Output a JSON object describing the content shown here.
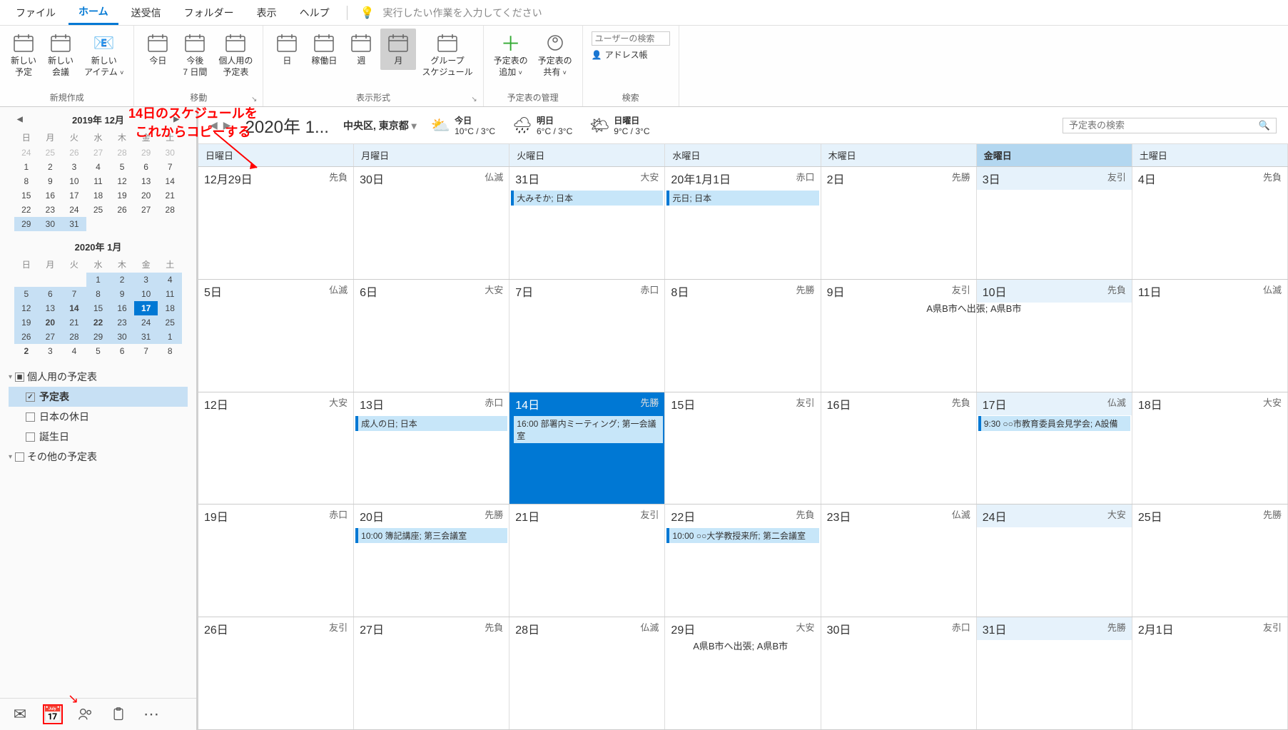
{
  "menubar": {
    "tabs": [
      "ファイル",
      "ホーム",
      "送受信",
      "フォルダー",
      "表示",
      "ヘルプ"
    ],
    "active": 1,
    "tellme": "実行したい作業を入力してください"
  },
  "ribbon": {
    "groups": [
      {
        "label": "新規作成",
        "items": [
          {
            "name": "new-appointment",
            "icon": "calendar-new",
            "label": "新しい\n予定"
          },
          {
            "name": "new-meeting",
            "icon": "calendar-meeting",
            "label": "新しい\n会議"
          },
          {
            "name": "new-items",
            "icon": "items",
            "label": "新しい\nアイテム",
            "dropdown": true
          }
        ]
      },
      {
        "label": "移動",
        "launcher": true,
        "items": [
          {
            "name": "today",
            "icon": "cal-today",
            "label": "今日"
          },
          {
            "name": "next-7-days",
            "icon": "cal-week",
            "label": "今後\n7 日間"
          },
          {
            "name": "personal-calendar",
            "icon": "cal-personal",
            "label": "個人用の\n予定表"
          }
        ]
      },
      {
        "label": "表示形式",
        "launcher": true,
        "items": [
          {
            "name": "day-view",
            "icon": "view-day",
            "label": "日"
          },
          {
            "name": "work-week-view",
            "icon": "view-workweek",
            "label": "稼働日"
          },
          {
            "name": "week-view",
            "icon": "view-week",
            "label": "週"
          },
          {
            "name": "month-view",
            "icon": "view-month",
            "label": "月",
            "active": true
          },
          {
            "name": "schedule-view",
            "icon": "view-schedule",
            "label": "グループ\nスケジュール"
          }
        ]
      },
      {
        "label": "予定表の管理",
        "items": [
          {
            "name": "add-calendar",
            "icon": "plus",
            "label": "予定表の\n追加",
            "dropdown": true
          },
          {
            "name": "share-calendar",
            "icon": "share",
            "label": "予定表の\n共有",
            "dropdown": true
          }
        ]
      },
      {
        "label": "検索",
        "search": true,
        "placeholder": "ユーザーの検索",
        "addressbook": "アドレス帳"
      }
    ]
  },
  "sidebar": {
    "miniCals": [
      {
        "title": "2019年 12月",
        "navLeft": true,
        "navRight": true,
        "dow": [
          "日",
          "月",
          "火",
          "水",
          "木",
          "金",
          "土"
        ],
        "days": [
          {
            "n": 24,
            "muted": true
          },
          {
            "n": 25,
            "muted": true
          },
          {
            "n": 26,
            "muted": true
          },
          {
            "n": 27,
            "muted": true
          },
          {
            "n": 28,
            "muted": true
          },
          {
            "n": 29,
            "muted": true
          },
          {
            "n": 30,
            "muted": true
          },
          {
            "n": 1
          },
          {
            "n": 2
          },
          {
            "n": 3
          },
          {
            "n": 4
          },
          {
            "n": 5
          },
          {
            "n": 6
          },
          {
            "n": 7
          },
          {
            "n": 8
          },
          {
            "n": 9
          },
          {
            "n": 10
          },
          {
            "n": 11
          },
          {
            "n": 12
          },
          {
            "n": 13
          },
          {
            "n": 14
          },
          {
            "n": 15
          },
          {
            "n": 16
          },
          {
            "n": 17
          },
          {
            "n": 18
          },
          {
            "n": 19
          },
          {
            "n": 20
          },
          {
            "n": 21
          },
          {
            "n": 22
          },
          {
            "n": 23
          },
          {
            "n": 24
          },
          {
            "n": 25
          },
          {
            "n": 26
          },
          {
            "n": 27
          },
          {
            "n": 28
          },
          {
            "n": 29,
            "hl": true
          },
          {
            "n": 30,
            "hl": true
          },
          {
            "n": 31,
            "hl": true
          },
          {
            "n": "",
            "muted": true
          },
          {
            "n": "",
            "muted": true
          },
          {
            "n": "",
            "muted": true
          },
          {
            "n": "",
            "muted": true
          }
        ]
      },
      {
        "title": "2020年 1月",
        "dow": [
          "日",
          "月",
          "火",
          "水",
          "木",
          "金",
          "土"
        ],
        "days": [
          {
            "n": "",
            "muted": true
          },
          {
            "n": "",
            "muted": true
          },
          {
            "n": "",
            "muted": true
          },
          {
            "n": 1,
            "hl": true
          },
          {
            "n": 2,
            "hl": true
          },
          {
            "n": 3,
            "hl": true
          },
          {
            "n": 4,
            "hl": true
          },
          {
            "n": 5,
            "hl": true
          },
          {
            "n": 6,
            "hl": true
          },
          {
            "n": 7,
            "hl": true
          },
          {
            "n": 8,
            "hl": true
          },
          {
            "n": 9,
            "hl": true
          },
          {
            "n": 10,
            "hl": true
          },
          {
            "n": 11,
            "hl": true
          },
          {
            "n": 12,
            "hl": true
          },
          {
            "n": 13,
            "hl": true
          },
          {
            "n": 14,
            "hl": true,
            "bold": true
          },
          {
            "n": 15,
            "hl": true
          },
          {
            "n": 16,
            "hl": true
          },
          {
            "n": 17,
            "today": true
          },
          {
            "n": 18,
            "hl": true
          },
          {
            "n": 19,
            "hl": true
          },
          {
            "n": 20,
            "hl": true,
            "bold": true
          },
          {
            "n": 21,
            "hl": true
          },
          {
            "n": 22,
            "hl": true,
            "bold": true
          },
          {
            "n": 23,
            "hl": true
          },
          {
            "n": 24,
            "hl": true
          },
          {
            "n": 25,
            "hl": true
          },
          {
            "n": 26,
            "hl": true
          },
          {
            "n": 27,
            "hl": true
          },
          {
            "n": 28,
            "hl": true
          },
          {
            "n": 29,
            "hl": true
          },
          {
            "n": 30,
            "hl": true
          },
          {
            "n": 31,
            "hl": true
          },
          {
            "n": 1,
            "hl": true
          },
          {
            "n": 2,
            "bold": true
          },
          {
            "n": 3
          },
          {
            "n": 4
          },
          {
            "n": 5
          },
          {
            "n": 6
          },
          {
            "n": 7
          },
          {
            "n": 8
          }
        ]
      }
    ],
    "calendarList": {
      "groups": [
        {
          "name": "個人用の予定表",
          "checked": "partial",
          "items": [
            {
              "name": "予定表",
              "checked": true,
              "selected": true
            },
            {
              "name": "日本の休日",
              "checked": false
            },
            {
              "name": "誕生日",
              "checked": false
            }
          ]
        },
        {
          "name": "その他の予定表",
          "checked": false,
          "items": []
        }
      ]
    }
  },
  "contentHeader": {
    "title": "2020年 1...",
    "location": "中央区, 東京都",
    "weather": [
      {
        "label": "今日",
        "temp": "10°C / 3°C",
        "icon": "⛅"
      },
      {
        "label": "明日",
        "temp": "6°C / 3°C",
        "icon": "🌧"
      },
      {
        "label": "日曜日",
        "temp": "9°C / 3°C",
        "icon": "🌤"
      }
    ],
    "searchPlaceholder": "予定表の検索"
  },
  "calendar": {
    "dayHeaders": [
      "日曜日",
      "月曜日",
      "火曜日",
      "水曜日",
      "木曜日",
      "金曜日",
      "土曜日"
    ],
    "highlightCol": 5,
    "rows": [
      [
        {
          "date": "12月29日",
          "r": "先負"
        },
        {
          "date": "30日",
          "r": "仏滅"
        },
        {
          "date": "31日",
          "r": "大安",
          "events": [
            {
              "text": "大みそか; 日本"
            }
          ]
        },
        {
          "date": "20年1月1日",
          "r": "赤口",
          "events": [
            {
              "text": "元日; 日本"
            }
          ]
        },
        {
          "date": "2日",
          "r": "先勝"
        },
        {
          "date": "3日",
          "r": "友引",
          "todayCol": true
        },
        {
          "date": "4日",
          "r": "先負"
        }
      ],
      [
        {
          "date": "5日",
          "r": "仏滅"
        },
        {
          "date": "6日",
          "r": "大安"
        },
        {
          "date": "7日",
          "r": "赤口"
        },
        {
          "date": "8日",
          "r": "先勝",
          "spanEvents": [
            {
              "text": "A県B市へ出張; A県B市",
              "span": 4
            }
          ]
        },
        {
          "date": "9日",
          "r": "友引"
        },
        {
          "date": "10日",
          "r": "先負",
          "todayCol": true
        },
        {
          "date": "11日",
          "r": "仏滅"
        }
      ],
      [
        {
          "date": "12日",
          "r": "大安"
        },
        {
          "date": "13日",
          "r": "赤口",
          "events": [
            {
              "text": "成人の日; 日本"
            }
          ]
        },
        {
          "date": "14日",
          "r": "先勝",
          "selected": true,
          "events": [
            {
              "text": "16:00 部署内ミーティング; 第一会議室"
            }
          ]
        },
        {
          "date": "15日",
          "r": "友引"
        },
        {
          "date": "16日",
          "r": "先負"
        },
        {
          "date": "17日",
          "r": "仏滅",
          "todayCol": true,
          "events": [
            {
              "text": "9:30 ○○市教育委員会見学会; A設備"
            }
          ]
        },
        {
          "date": "18日",
          "r": "大安"
        }
      ],
      [
        {
          "date": "19日",
          "r": "赤口"
        },
        {
          "date": "20日",
          "r": "先勝",
          "events": [
            {
              "text": "10:00 簿記講座; 第三会議室"
            }
          ]
        },
        {
          "date": "21日",
          "r": "友引"
        },
        {
          "date": "22日",
          "r": "先負",
          "events": [
            {
              "text": "10:00 ○○大学教授来所; 第二会議室"
            }
          ]
        },
        {
          "date": "23日",
          "r": "仏滅"
        },
        {
          "date": "24日",
          "r": "大安",
          "todayCol": true
        },
        {
          "date": "25日",
          "r": "先勝"
        }
      ],
      [
        {
          "date": "26日",
          "r": "友引"
        },
        {
          "date": "27日",
          "r": "先負",
          "spanEvents": [
            {
              "text": "A県B市へ出張; A県B市",
              "span": 5
            }
          ]
        },
        {
          "date": "28日",
          "r": "仏滅"
        },
        {
          "date": "29日",
          "r": "大安"
        },
        {
          "date": "30日",
          "r": "赤口"
        },
        {
          "date": "31日",
          "r": "先勝",
          "todayCol": true
        },
        {
          "date": "2月1日",
          "r": "友引"
        }
      ]
    ]
  },
  "callout": {
    "line1": "14日のスケジュールを",
    "line2": "これからコピーする"
  }
}
